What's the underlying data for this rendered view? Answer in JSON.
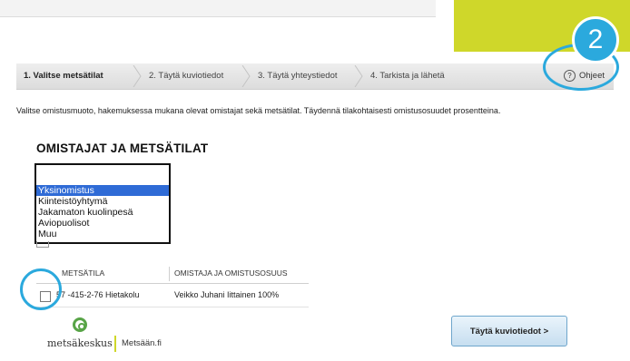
{
  "steps": [
    {
      "label": "1. Valitse metsätilat"
    },
    {
      "label": "2. Täytä kuviotiedot"
    },
    {
      "label": "3. Täytä yhteystiedot"
    },
    {
      "label": "4. Tarkista ja lähetä"
    }
  ],
  "help": {
    "icon": "?",
    "label": "Ohjeet"
  },
  "badge": {
    "number": "2"
  },
  "intro": "Valitse omistusmuoto, hakemuksessa mukana olevat omistajat sekä metsätilat. Täydennä tilakohtaisesti omistusosuudet prosentteina.",
  "section_title": "OMISTAJAT JA METSÄTILAT",
  "ownership_options": [
    "Yksinomistus",
    "Kiinteistöyhtymä",
    "Jakamaton kuolinpesä",
    "Aviopuolisot",
    "Muu"
  ],
  "table": {
    "headers": [
      "METSÄTILA",
      "OMISTAJA JA OMISTUSOSUUS"
    ],
    "rows": [
      {
        "estate": "57 -415-2-76 Hietakolu",
        "owner": "Veikko Juhani Iittainen 100%"
      }
    ]
  },
  "logo": {
    "brand": "metsäkeskus",
    "site": "Metsään.fi"
  },
  "next_button": "Täytä kuviotiedot >",
  "colors": {
    "accent_green": "#cfd72a",
    "highlight_blue": "#2ba9dd",
    "selected_option": "#2f6bd6"
  }
}
